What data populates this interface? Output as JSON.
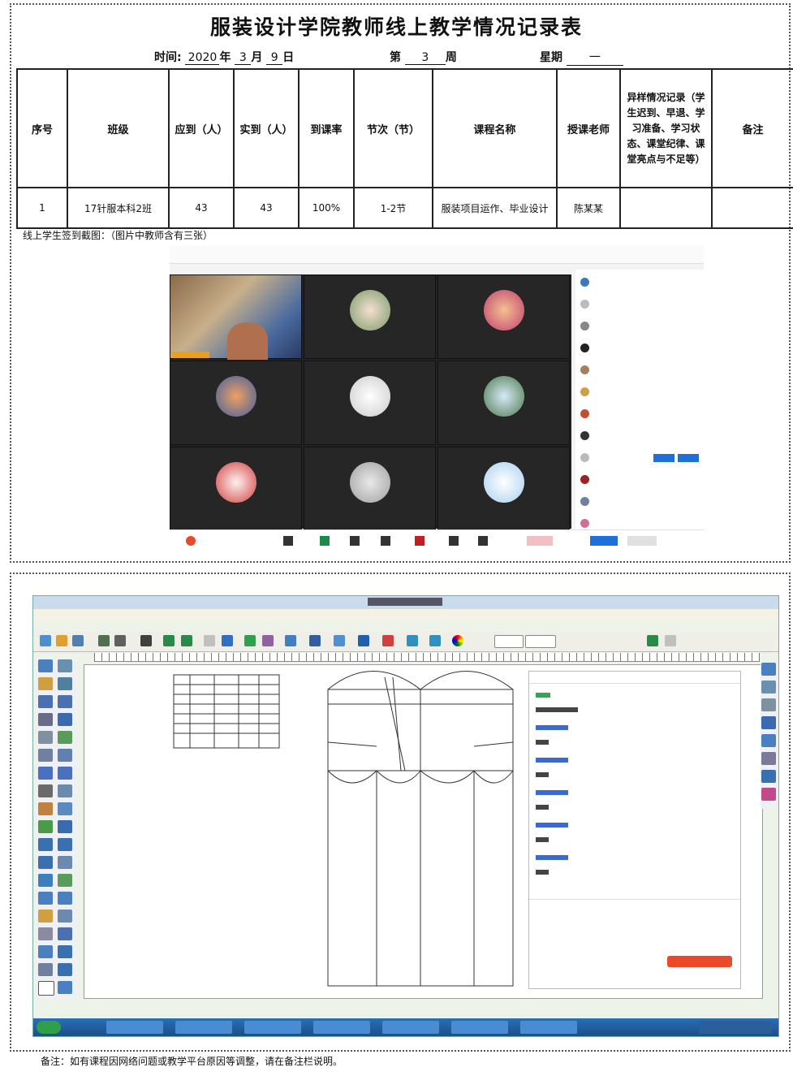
{
  "title": "服装设计学院教师线上教学情况记录表",
  "meta": {
    "time_label": "时间:",
    "year": "2020",
    "year_unit": "年",
    "month": "3",
    "month_unit": "月",
    "day": "9",
    "day_unit": "日",
    "week_prefix": "第",
    "week": "3",
    "week_unit": "周",
    "weekday_label": "星期",
    "weekday": "一"
  },
  "table": {
    "headers": [
      "序号",
      "班级",
      "应到（人）",
      "实到（人）",
      "到课率",
      "节次（节）",
      "课程名称",
      "授课老师",
      "异样情况记录（学生迟到、早退、学习准备、学习状态、课堂纪律、课堂亮点与不足等）",
      "备注"
    ],
    "row": [
      "1",
      "17针服本科2班",
      "43",
      "43",
      "100%",
      "1-2节",
      "服装项目运作、毕业设计",
      "陈某某",
      "",
      ""
    ]
  },
  "photo_label": "线上学生签到截图：（图片中教师含有三张）",
  "note": "备注：如有课程因网络问题或教学平台原因等调整，请在备注栏说明。",
  "colors": {
    "frame": "#555555",
    "taskbar": "#1b4f8a",
    "accent_blue": "#1e6fd9"
  }
}
